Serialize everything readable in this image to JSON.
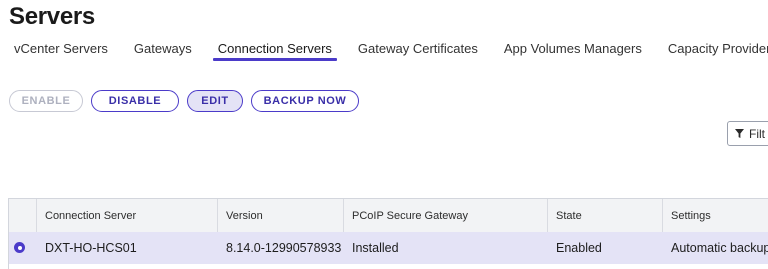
{
  "page": {
    "title": "Servers"
  },
  "tabs": [
    {
      "label": "vCenter Servers"
    },
    {
      "label": "Gateways"
    },
    {
      "label": "Connection Servers",
      "active": true
    },
    {
      "label": "Gateway Certificates"
    },
    {
      "label": "App Volumes Managers"
    },
    {
      "label": "Capacity Providers"
    }
  ],
  "toolbar": {
    "enable_label": "ENABLE",
    "disable_label": "DISABLE",
    "edit_label": "EDIT",
    "backup_label": "BACKUP NOW"
  },
  "filter": {
    "label": "Filt",
    "icon": "filter-icon"
  },
  "table": {
    "columns": [
      "Connection Server",
      "Version",
      "PCoIP Secure Gateway",
      "State",
      "Settings"
    ],
    "rows": [
      {
        "selected": true,
        "cells": [
          "DXT-HO-HCS01",
          "8.14.0-12990578933",
          "Installed",
          "Enabled",
          "Automatic backup"
        ]
      }
    ]
  },
  "colors": {
    "accent": "#4b3bc9",
    "selected_row": "#e4e3f6",
    "header_bg": "#f2f3f5"
  }
}
